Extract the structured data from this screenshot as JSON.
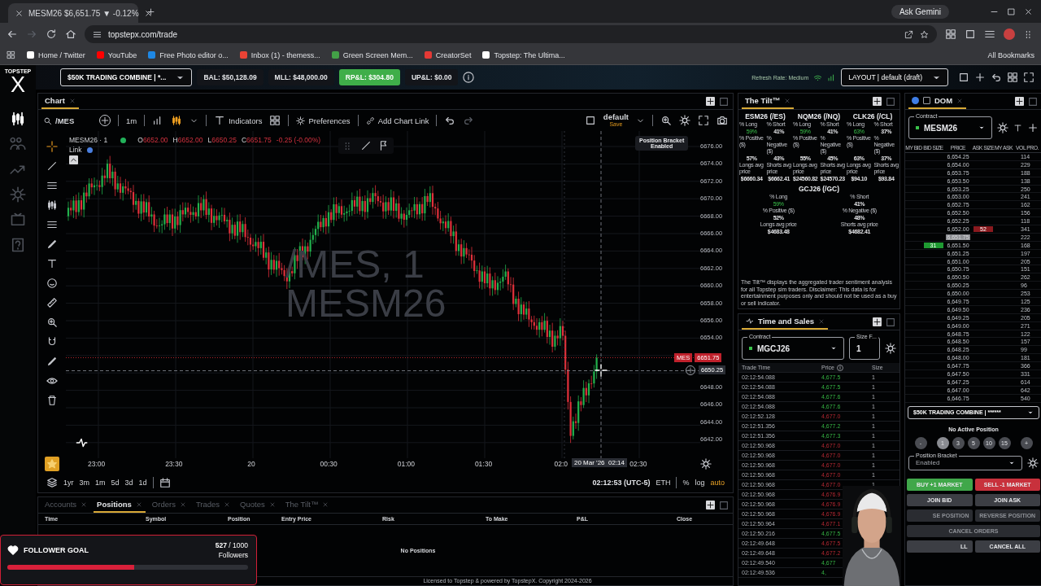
{
  "browser": {
    "tab_title": "MESM26 $6,651.75 ▼ -0.12%",
    "gemini": "Ask Gemini",
    "url": "topstepx.com/trade",
    "bookmarks": [
      {
        "label": "Home / Twitter",
        "color": "#ffffff"
      },
      {
        "label": "YouTube",
        "color": "#ff0000"
      },
      {
        "label": "Free Photo editor o...",
        "color": "#1e88e5"
      },
      {
        "label": "Inbox (1) - themess...",
        "color": "#ea4335"
      },
      {
        "label": "Green Screen Mem...",
        "color": "#43a047"
      },
      {
        "label": "CreatorSet",
        "color": "#e53935"
      },
      {
        "label": "Topstep: The Ultima...",
        "color": "#ffffff"
      }
    ],
    "all_bookmarks": "All Bookmarks"
  },
  "app": {
    "logo_top": "TOPSTEP",
    "logo_mark": "X",
    "account": "$50K TRADING COMBINE | *...",
    "stats": [
      {
        "label": "BAL: $50,128.09",
        "highlight": false
      },
      {
        "label": "MLL: $48,000.00",
        "highlight": false
      },
      {
        "label": "RP&L: $304.80",
        "highlight": true
      },
      {
        "label": "UP&L: $0.00",
        "highlight": false
      }
    ],
    "refresh": "Refresh Rate: Medium",
    "layout": "LAYOUT | default (draft)"
  },
  "chart": {
    "tab": "Chart",
    "symbol": "/MES",
    "interval": "1m",
    "indicators": "Indicators",
    "preferences": "Preferences",
    "add_link": "Add Chart Link",
    "layout_name": "default",
    "save": "Save",
    "legend": {
      "title": "MESM26 · 1",
      "ohlc": [
        {
          "key": "O",
          "value": "6652.00"
        },
        {
          "key": "H",
          "value": "6652.00"
        },
        {
          "key": "L",
          "value": "6650.25"
        },
        {
          "key": "C",
          "value": "6651.75"
        }
      ],
      "change": "-0.25 (-0.00%)",
      "link": "Link"
    },
    "tooltip": {
      "title": "Position Bracket",
      "value": "Enabled"
    },
    "watermark": [
      "/MES, 1",
      "MESM26"
    ],
    "price_labels_upper": [
      "6676.00",
      "6674.00",
      "6672.00",
      "6670.00",
      "6668.00",
      "6666.00",
      "6664.00",
      "6662.00",
      "6660.00",
      "6658.00",
      "6656.00",
      "6654.00"
    ],
    "price_labels_lower": [
      "6648.00",
      "6646.00",
      "6644.00",
      "6642.00"
    ],
    "last_price": {
      "symbol": "MES",
      "value": "6651.75"
    },
    "crosshair_price": "6650.25",
    "time_labels": [
      "23:00",
      "23:30",
      "20",
      "00:30",
      "01:00",
      "01:30",
      "02:0",
      "02:30"
    ],
    "crosshair_time": "20 Mar '26  02:14",
    "ranges": [
      "1yr",
      "3m",
      "1m",
      "5d",
      "3d",
      "1d"
    ],
    "clock": "02:12:53 (UTC-5)",
    "session": "ETH",
    "percent": "%",
    "log": "log",
    "auto": "auto"
  },
  "bottom_panel": {
    "tabs": [
      {
        "label": "Accounts",
        "selected": false
      },
      {
        "label": "Positions",
        "selected": true
      },
      {
        "label": "Orders",
        "selected": false
      },
      {
        "label": "Trades",
        "selected": false
      },
      {
        "label": "Quotes",
        "selected": false
      },
      {
        "label": "The Tilt™",
        "selected": false
      }
    ],
    "columns": [
      "Time",
      "Symbol",
      "Position",
      "Entry Price",
      "Risk",
      "To Make",
      "P&L",
      "Close"
    ],
    "empty": "No Positions",
    "footer": "Licensed to Topstep & powered by TopstepX. Copyright 2024-2026"
  },
  "tilt": {
    "tab": "The Tilt™",
    "instruments": [
      {
        "symbol": "ESM26 (/ES)",
        "stats": [
          {
            "label": "% Long",
            "value": "59%",
            "highlight": true
          },
          {
            "label": "% Short",
            "value": "41%",
            "highlight": false
          },
          {
            "label": "% Positive ($)",
            "value": "57%",
            "highlight": false
          },
          {
            "label": "% Negative ($)",
            "value": "43%",
            "highlight": false
          },
          {
            "label": "Longs avg price",
            "value": "$6660.34",
            "highlight": false
          },
          {
            "label": "Shorts avg price",
            "value": "$6662.41",
            "highlight": false
          }
        ]
      },
      {
        "symbol": "NQM26 (/NQ)",
        "stats": [
          {
            "label": "% Long",
            "value": "59%",
            "highlight": true
          },
          {
            "label": "% Short",
            "value": "41%",
            "highlight": false
          },
          {
            "label": "% Positive ($)",
            "value": "55%",
            "highlight": false
          },
          {
            "label": "% Negative ($)",
            "value": "45%",
            "highlight": false
          },
          {
            "label": "Longs avg price",
            "value": "$24560.82",
            "highlight": false
          },
          {
            "label": "Shorts avg price",
            "value": "$24570.23",
            "highlight": false
          }
        ]
      },
      {
        "symbol": "CLK26 (/CL)",
        "stats": [
          {
            "label": "% Long",
            "value": "63%",
            "highlight": true
          },
          {
            "label": "% Short",
            "value": "37%",
            "highlight": false
          },
          {
            "label": "% Positive ($)",
            "value": "63%",
            "highlight": false
          },
          {
            "label": "% Negative ($)",
            "value": "37%",
            "highlight": false
          },
          {
            "label": "Longs avg price",
            "value": "$94.10",
            "highlight": false
          },
          {
            "label": "Shorts avg price",
            "value": "$93.84",
            "highlight": false
          }
        ]
      },
      {
        "symbol": "GCJ26 (/GC)",
        "stats": [
          {
            "label": "% Long",
            "value": "59%",
            "highlight": true
          },
          {
            "label": "% Short",
            "value": "41%",
            "highlight": false
          },
          {
            "label": "% Positive ($)",
            "value": "52%",
            "highlight": false
          },
          {
            "label": "% Negative ($)",
            "value": "48%",
            "highlight": false
          },
          {
            "label": "Longs avg price",
            "value": "$4683.48",
            "highlight": false
          },
          {
            "label": "Shorts avg price",
            "value": "$4682.41",
            "highlight": false
          }
        ]
      }
    ],
    "disclaimer": "The Tilt™ displays the aggregated trader sentiment analysis for all Topstep sim traders. Disclaimer: This data is for entertainment purposes only and should not be used as a buy or sell indicator."
  },
  "time_sales": {
    "tab": "Time and Sales",
    "contract_label": "Contract",
    "contract": "MGCJ26",
    "size_label": "Size F...",
    "size": "1",
    "columns": [
      "Trade Time",
      "Price",
      "Size"
    ],
    "rows": [
      {
        "time": "02:12:54.088",
        "price": "4,677.5",
        "kind": "up",
        "size": "1"
      },
      {
        "time": "02:12:54.088",
        "price": "4,677.5",
        "kind": "up",
        "size": "1"
      },
      {
        "time": "02:12:54.088",
        "price": "4,677.6",
        "kind": "up",
        "size": "1"
      },
      {
        "time": "02:12:54.088",
        "price": "4,677.6",
        "kind": "up",
        "size": "1"
      },
      {
        "time": "02:12:52.128",
        "price": "4,677.0",
        "kind": "down",
        "size": "1"
      },
      {
        "time": "02:12:51.356",
        "price": "4,677.2",
        "kind": "up",
        "size": "1"
      },
      {
        "time": "02:12:51.356",
        "price": "4,677.3",
        "kind": "up",
        "size": "1"
      },
      {
        "time": "02:12:50.968",
        "price": "4,677.0",
        "kind": "down",
        "size": "1"
      },
      {
        "time": "02:12:50.968",
        "price": "4,677.0",
        "kind": "down",
        "size": "1"
      },
      {
        "time": "02:12:50.968",
        "price": "4,677.0",
        "kind": "down",
        "size": "1"
      },
      {
        "time": "02:12:50.968",
        "price": "4,677.0",
        "kind": "down",
        "size": "1"
      },
      {
        "time": "02:12:50.968",
        "price": "4,677.0",
        "kind": "down",
        "size": "1"
      },
      {
        "time": "02:12:50.968",
        "price": "4,676.9",
        "kind": "down"
      },
      {
        "time": "02:12:50.968",
        "price": "4,676.9",
        "kind": "down"
      },
      {
        "time": "02:12:50.968",
        "price": "4,676.9",
        "kind": "down"
      },
      {
        "time": "02:12:50.964",
        "price": "4,677.1",
        "kind": "down"
      },
      {
        "time": "02:12:50.216",
        "price": "4,677.5",
        "kind": "up"
      },
      {
        "time": "02:12:49.648",
        "price": "4,677.5",
        "kind": "down"
      },
      {
        "time": "02:12:49.648",
        "price": "4,677.2",
        "kind": "down"
      },
      {
        "time": "02:12:49.540",
        "price": "4,677",
        "kind": "up"
      },
      {
        "time": "02:12:49.536",
        "price": "4,",
        "kind": "up"
      }
    ]
  },
  "dom": {
    "tab": "DOM",
    "contract_label": "Contract",
    "contract": "MESM26",
    "columns": [
      "MY BID",
      "BID SIZE",
      "PRICE",
      "ASK SIZE",
      "MY ASK",
      "VOL PRO."
    ],
    "rows": [
      {
        "price": "6,654.25",
        "vol": "114",
        "last": false
      },
      {
        "price": "6,654.00",
        "vol": "229",
        "last": false
      },
      {
        "price": "6,653.75",
        "vol": "188",
        "last": false
      },
      {
        "price": "6,653.50",
        "vol": "138",
        "last": false
      },
      {
        "price": "6,653.25",
        "vol": "250",
        "last": false
      },
      {
        "price": "6,653.00",
        "vol": "241",
        "last": false
      },
      {
        "price": "6,652.75",
        "vol": "162",
        "last": false
      },
      {
        "price": "6,652.50",
        "vol": "156",
        "last": false
      },
      {
        "price": "6,652.25",
        "vol": "118",
        "last": false
      },
      {
        "price": "6,652.00",
        "vol": "341",
        "ask": "52",
        "last": false
      },
      {
        "price": "6,651.75",
        "vol": "222",
        "last": true
      },
      {
        "price": "6,651.50",
        "vol": "168",
        "bid": "31",
        "last": false
      },
      {
        "price": "6,651.25",
        "vol": "197",
        "last": false
      },
      {
        "price": "6,651.00",
        "vol": "205",
        "last": false
      },
      {
        "price": "6,650.75",
        "vol": "151",
        "last": false
      },
      {
        "price": "6,650.50",
        "vol": "262",
        "last": false
      },
      {
        "price": "6,650.25",
        "vol": "96",
        "last": false
      },
      {
        "price": "6,650.00",
        "vol": "253",
        "last": false
      },
      {
        "price": "6,649.75",
        "vol": "125",
        "last": false
      },
      {
        "price": "6,649.50",
        "vol": "236",
        "last": false
      },
      {
        "price": "6,649.25",
        "vol": "205",
        "last": false
      },
      {
        "price": "6,649.00",
        "vol": "271",
        "last": false
      },
      {
        "price": "6,648.75",
        "vol": "122",
        "last": false
      },
      {
        "price": "6,648.50",
        "vol": "157",
        "last": false
      },
      {
        "price": "6,648.25",
        "vol": "99",
        "last": false
      },
      {
        "price": "6,648.00",
        "vol": "181",
        "last": false
      },
      {
        "price": "6,647.75",
        "vol": "366",
        "last": false
      },
      {
        "price": "6,647.50",
        "vol": "331",
        "last": false
      },
      {
        "price": "6,647.25",
        "vol": "614",
        "last": false
      },
      {
        "price": "6,647.00",
        "vol": "642",
        "last": false
      },
      {
        "price": "6,646.75",
        "vol": "540",
        "last": false
      }
    ],
    "account": "$50K TRADING COMBINE | ******",
    "position": "No Active Position",
    "quantities": [
      {
        "label": "-",
        "kind": "step",
        "selected": false
      },
      {
        "label": "1",
        "kind": "qty",
        "selected": true
      },
      {
        "label": "3",
        "kind": "qty",
        "selected": false
      },
      {
        "label": "5",
        "kind": "qty",
        "selected": false
      },
      {
        "label": "10",
        "kind": "qty",
        "selected": false
      },
      {
        "label": "15",
        "kind": "qty",
        "selected": false
      },
      {
        "label": "+",
        "kind": "step",
        "selected": false
      }
    ],
    "bracket_label": "Position Bracket",
    "bracket": "Enabled",
    "buttons": [
      {
        "label": "BUY +1 MARKET",
        "kind": "buy",
        "disabled": false
      },
      {
        "label": "SELL -1 MARKET",
        "kind": "sell",
        "disabled": false
      },
      {
        "label": "JOIN BID",
        "kind": "plain",
        "disabled": false
      },
      {
        "label": "JOIN ASK",
        "kind": "plain",
        "disabled": false
      },
      {
        "label": "SE POSITION",
        "kind": "plain",
        "disabled": true
      },
      {
        "label": "REVERSE POSITION",
        "kind": "plain",
        "disabled": true
      },
      {
        "label": "CANCEL ORDERS",
        "kind": "wide",
        "disabled": true
      },
      {
        "label": "LL",
        "kind": "plain",
        "disabled": false
      },
      {
        "label": "CANCEL ALL",
        "kind": "plain",
        "disabled": false
      }
    ]
  },
  "follower_goal": {
    "title": "FOLLOWER GOAL",
    "count": "527",
    "target": "/ 1000",
    "unit": "Followers",
    "level": 0.527
  }
}
